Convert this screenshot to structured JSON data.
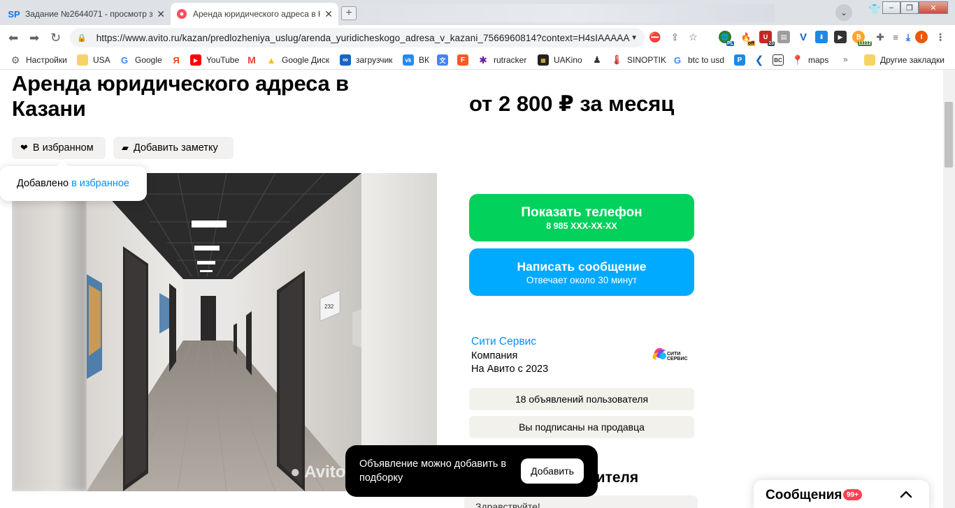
{
  "browser": {
    "tabs": [
      {
        "favicon": "SP",
        "title": "Задание №2644071 - просмотр з...",
        "active": false
      },
      {
        "favicon": "avito-icon",
        "title": "Аренда юридического адреса в К",
        "active": true
      }
    ],
    "url": "https://www.avito.ru/kazan/predlozheniya_uslug/arenda_yuridicheskogo_adresa_v_kazani_7566960814?context=H4sIAAAAA...",
    "bookmarks": [
      {
        "label": "Настройки",
        "icon": "gear-icon"
      },
      {
        "label": "USA",
        "icon": "folder-icon"
      },
      {
        "label": "Google",
        "icon": "google-icon"
      },
      {
        "label": "Я",
        "icon": "yandex-icon"
      },
      {
        "label": "YouTube",
        "icon": "youtube-icon"
      },
      {
        "label": "",
        "icon": "gmail-icon"
      },
      {
        "label": "Google Диск",
        "icon": "drive-icon"
      },
      {
        "label": "загрузчик",
        "icon": "infinity-icon"
      },
      {
        "label": "ВК",
        "icon": "vk-icon"
      },
      {
        "label": "",
        "icon": "translate-icon"
      },
      {
        "label": "",
        "icon": "f-icon"
      },
      {
        "label": "rutracker",
        "icon": "rutracker-icon"
      },
      {
        "label": "UAKino",
        "icon": "uakino-icon"
      },
      {
        "label": "",
        "icon": "figure-icon"
      },
      {
        "label": "SINOPTIK",
        "icon": "thermometer-icon"
      },
      {
        "label": "btc to usd",
        "icon": "google-icon"
      },
      {
        "label": "",
        "icon": "p-icon"
      },
      {
        "label": "",
        "icon": "arrow-icon"
      },
      {
        "label": "",
        "icon": "bc-icon"
      },
      {
        "label": "maps",
        "icon": "maps-icon"
      },
      {
        "label": "»",
        "icon": ""
      },
      {
        "label": "Другие закладки",
        "icon": "folder-icon"
      }
    ],
    "ext_badges": {
      "pl": "PL",
      "off": "off",
      "n23": "23",
      "n11112": "11112",
      "avatar": "I"
    }
  },
  "listing": {
    "title": "Аренда юридического адреса в Казани",
    "price": "от 2 800 ₽ за месяц",
    "favorite_label": "В избранном",
    "note_label": "Добавить заметку",
    "watermark": "Avito"
  },
  "toast_fav": {
    "text": "Добавлено",
    "link": "в избранное"
  },
  "contact": {
    "phone_label": "Показать телефон",
    "phone_masked": "8 985 XXX-XX-XX",
    "message_label": "Написать сообщение",
    "message_sub": "Отвечает около 30 минут"
  },
  "seller": {
    "name": "Сити Сервис",
    "type": "Компания",
    "since": "На Авито с 2023",
    "logo_text_1": "СИТИ",
    "logo_text_2": "СЕРВИС",
    "ads_count": "18 объявлений пользователя",
    "subscribed": "Вы подписаны на продавца"
  },
  "ask_section": {
    "heading_partial": "нителя",
    "input_placeholder": "Здравствуйте!"
  },
  "toast_collection": {
    "text": "Объявление можно добавить в подборку",
    "button": "Добавить"
  },
  "messenger": {
    "label": "Сообщения",
    "badge": "99+"
  },
  "colors": {
    "green": "#02d15c",
    "blue": "#00aaff",
    "link": "#0091ff",
    "badge": "#ff4053"
  }
}
